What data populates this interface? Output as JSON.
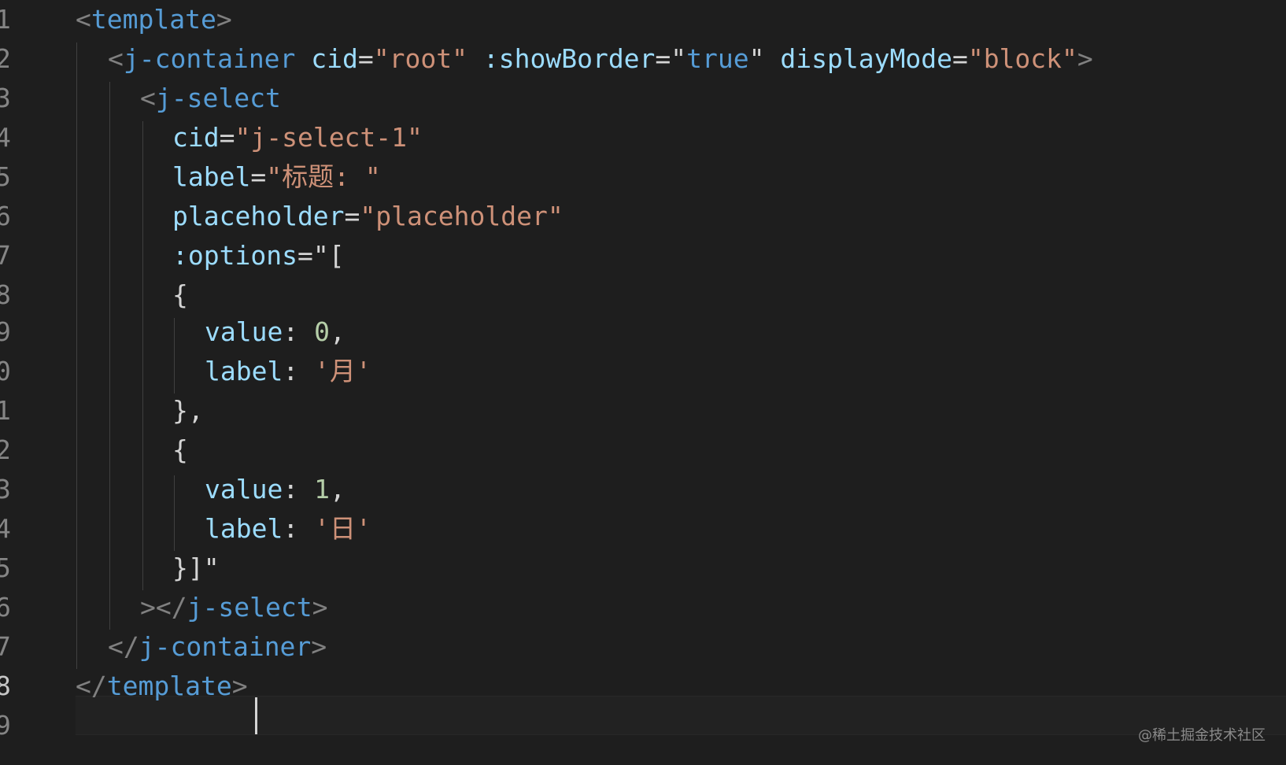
{
  "gutter": [
    "1",
    "2",
    "3",
    "4",
    "5",
    "6",
    "7",
    "8",
    "9",
    "0",
    "1",
    "2",
    "3",
    "4",
    "5",
    "6",
    "7",
    "8",
    "9"
  ],
  "code": {
    "l1": {
      "lt": "<",
      "tag": "template",
      "gt": ">"
    },
    "l2": {
      "lt": "<",
      "tag": "j-container",
      "a1": "cid",
      "eq1": "=",
      "v1": "\"root\"",
      "a2": ":showBorder",
      "eq2": "=",
      "v2q1": "\"",
      "v2": "true",
      "v2q2": "\"",
      "a3": "displayMode",
      "eq3": "=",
      "v3": "\"block\"",
      "gt": ">"
    },
    "l3": {
      "lt": "<",
      "tag": "j-select"
    },
    "l4": {
      "attr": "cid",
      "eq": "=",
      "val": "\"j-select-1\""
    },
    "l5": {
      "attr": "label",
      "eq": "=",
      "val": "\"标题: \""
    },
    "l6": {
      "attr": "placeholder",
      "eq": "=",
      "val": "\"placeholder\""
    },
    "l7": {
      "attr": ":options",
      "eq": "=",
      "rest": "\"["
    },
    "l8": {
      "text": "{"
    },
    "l9": {
      "key": "value",
      "colon": ": ",
      "num": "0",
      "comma": ","
    },
    "l10": {
      "key": "label",
      "colon": ": ",
      "str": "'月'"
    },
    "l11": {
      "text": "},"
    },
    "l12": {
      "text": "{"
    },
    "l13": {
      "key": "value",
      "colon": ": ",
      "num": "1",
      "comma": ","
    },
    "l14": {
      "key": "label",
      "colon": ": ",
      "str": "'日'"
    },
    "l15": {
      "text": "}]\""
    },
    "l16": {
      "gt": ">",
      "lt": "</",
      "tag": "j-select",
      "gt2": ">"
    },
    "l17": {
      "lt": "</",
      "tag": "j-container",
      "gt": ">"
    },
    "l18": {
      "lt": "</",
      "tag": "template",
      "gt": ">"
    }
  },
  "watermark": "@稀土掘金技术社区",
  "colors": {
    "background": "#1e1e1e",
    "tag": "#569cd6",
    "attribute": "#9cdcfe",
    "string": "#ce9178",
    "number": "#b5cea8",
    "bracket": "#808080",
    "line_number": "#858585"
  }
}
